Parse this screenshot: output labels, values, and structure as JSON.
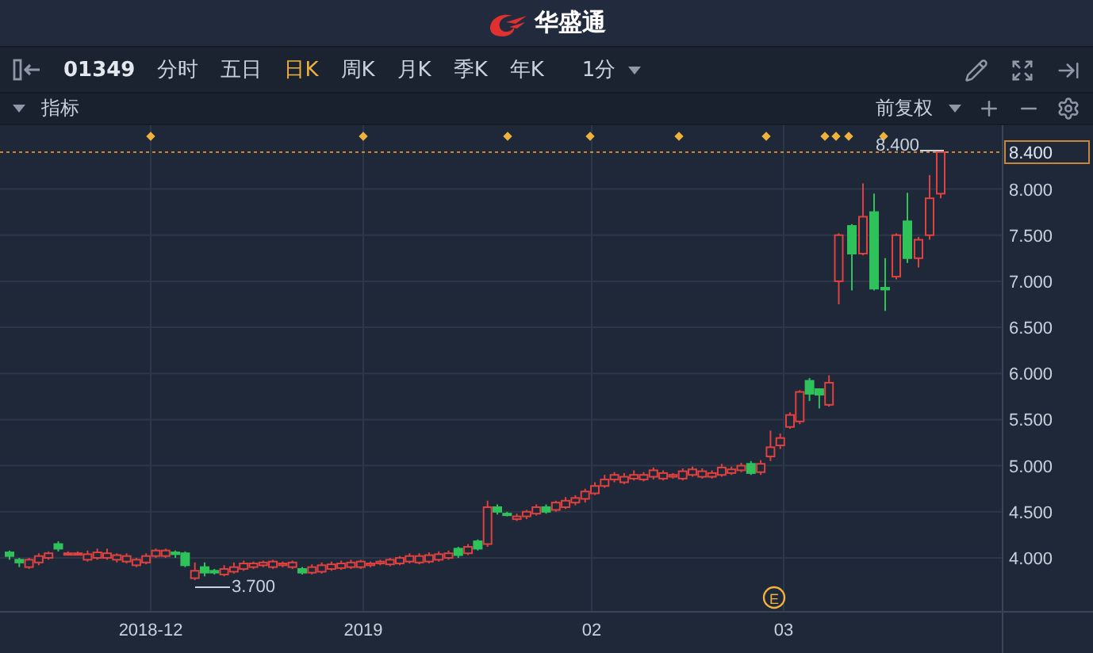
{
  "header": {
    "brand": "华盛通"
  },
  "toolbar": {
    "symbol": "01349",
    "periods": [
      {
        "label": "分时",
        "selected": false
      },
      {
        "label": "五日",
        "selected": false
      },
      {
        "label": "日K",
        "selected": true
      },
      {
        "label": "周K",
        "selected": false
      },
      {
        "label": "月K",
        "selected": false
      },
      {
        "label": "季K",
        "selected": false
      },
      {
        "label": "年K",
        "selected": false
      }
    ],
    "interval": "1分"
  },
  "indicator_bar": {
    "label": "指标",
    "adjustment": "前复权"
  },
  "chart": {
    "y_ticks": [
      "8.000",
      "7.500",
      "7.000",
      "6.500",
      "6.000",
      "5.500",
      "5.000",
      "4.500",
      "4.000"
    ],
    "current_price": "8.400",
    "high_label": "8.400",
    "low_label": "3.700",
    "x_labels": [
      "2018-12",
      "2019",
      "02",
      "03"
    ],
    "event_marker": "E"
  }
}
